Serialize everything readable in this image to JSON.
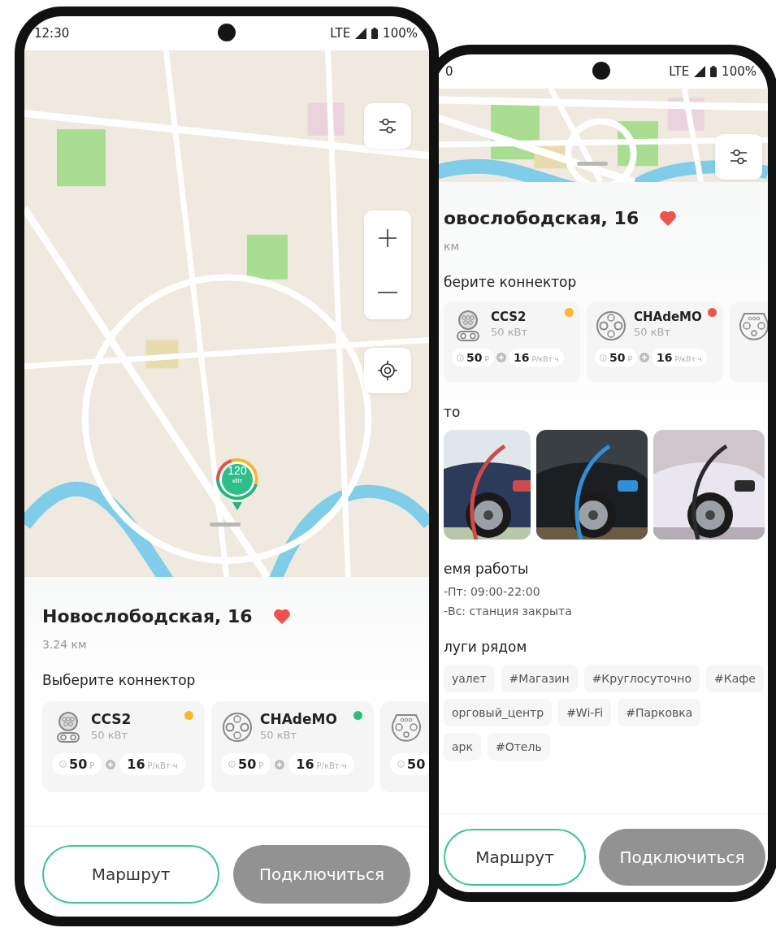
{
  "phones": [
    {
      "status_bar": {
        "time": "12:30",
        "network": "LTE",
        "battery": "100%"
      },
      "map": {
        "kind": "picture"
      },
      "map_controls": [
        {
          "kind": "filter"
        },
        {
          "kind": "zoom"
        },
        {
          "kind": "locate"
        }
      ],
      "marker": {
        "power": "120",
        "unit": "кВт"
      },
      "station": {
        "title": "Новослободская, 16",
        "favorite": true,
        "distance": "3.24 км"
      },
      "connectors_heading": "Выберите коннектор",
      "connectors": [
        {
          "kind": "ccs2",
          "name": "CCS2",
          "power": "50 кВт",
          "color": "#f5b82e",
          "fee": "50",
          "fee_unit": "Р",
          "price": "16",
          "price_unit": "Р/кВт·ч"
        },
        {
          "kind": "chademo",
          "name": "CHAdeMO",
          "power": "50 кВт",
          "color": "#27c07f",
          "fee": "50",
          "fee_unit": "Р",
          "price": "16",
          "price_unit": "Р/кВт·ч"
        },
        {
          "kind": "type2",
          "fee": "50"
        }
      ],
      "buttons": [
        {
          "label": "Маршрут",
          "disabled": false
        },
        {
          "label": "Подключиться",
          "disabled": true
        }
      ]
    },
    {
      "status_bar": {
        "time": "0",
        "network": "LTE",
        "battery": "100%"
      },
      "map": {
        "kind": "picture"
      },
      "map_controls": [
        {
          "kind": "filter"
        }
      ],
      "station": {
        "title": "овослободская, 16",
        "favorite": true,
        "distance": "км"
      },
      "connectors_heading": "берите коннектор",
      "connectors": [
        {
          "kind": "ccs2",
          "name": "CCS2",
          "power": "50 кВт",
          "color": "#f5b82e",
          "fee": "50",
          "fee_unit": "Р",
          "price": "16",
          "price_unit": "Р/кВт·ч"
        },
        {
          "kind": "chademo",
          "name": "CHAdeMO",
          "power": "50 кВт",
          "color": "#f0524f",
          "fee": "50",
          "fee_unit": "Р",
          "price": "16",
          "price_unit": "Р/кВт·ч"
        },
        {
          "kind": "type2"
        }
      ],
      "photos_heading": "то",
      "photos": [
        {
          "kind": "picture"
        },
        {
          "kind": "picture"
        },
        {
          "kind": "picture"
        }
      ],
      "hours_heading": "емя работы",
      "hours": [
        "-Пт: 09:00-22:00",
        "-Вс: станция закрыта"
      ],
      "services_heading": "луги рядом",
      "tag_rows": [
        [
          "уалет",
          "#Магазин",
          "#Круглосуточно",
          "#Кафе"
        ],
        [
          "орговый_центр",
          "#Wi-Fi",
          "#Парковка"
        ],
        [
          "арк",
          "#Отель"
        ]
      ],
      "buttons": [
        {
          "label": "Маршрут",
          "disabled": false
        },
        {
          "label": "Подключиться",
          "disabled": true
        }
      ]
    }
  ]
}
